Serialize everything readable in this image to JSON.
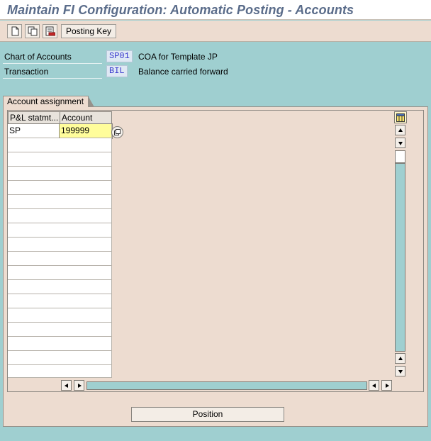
{
  "window": {
    "title": "Maintain FI Configuration: Automatic Posting - Accounts"
  },
  "toolbar": {
    "icons": [
      "new-entries-icon",
      "copy-icon",
      "delete-icon"
    ],
    "posting_key_label": "Posting Key"
  },
  "header": {
    "chart_of_accounts": {
      "label": "Chart of Accounts",
      "value": "SP01",
      "description": "COA for Template JP"
    },
    "transaction": {
      "label": "Transaction",
      "value": "BIL",
      "description": "Balance carried forward"
    }
  },
  "account_assignment": {
    "group_label": "Account assignment",
    "columns": [
      "P&L statmt...",
      "Account"
    ],
    "rows": [
      [
        "SP",
        "199999"
      ],
      [
        "",
        ""
      ],
      [
        "",
        ""
      ],
      [
        "",
        ""
      ],
      [
        "",
        ""
      ],
      [
        "",
        ""
      ],
      [
        "",
        ""
      ],
      [
        "",
        ""
      ],
      [
        "",
        ""
      ],
      [
        "",
        ""
      ],
      [
        "",
        ""
      ],
      [
        "",
        ""
      ],
      [
        "",
        ""
      ],
      [
        "",
        ""
      ],
      [
        "",
        ""
      ],
      [
        "",
        ""
      ],
      [
        "",
        ""
      ],
      [
        "",
        ""
      ]
    ]
  },
  "footer": {
    "position_label": "Position"
  },
  "colors": {
    "background": "#9fcfd0",
    "panel": "#eddcd0",
    "title": "#5a6c8a",
    "input_highlight": "#fffd9b",
    "key_text": "#3a3acd"
  }
}
